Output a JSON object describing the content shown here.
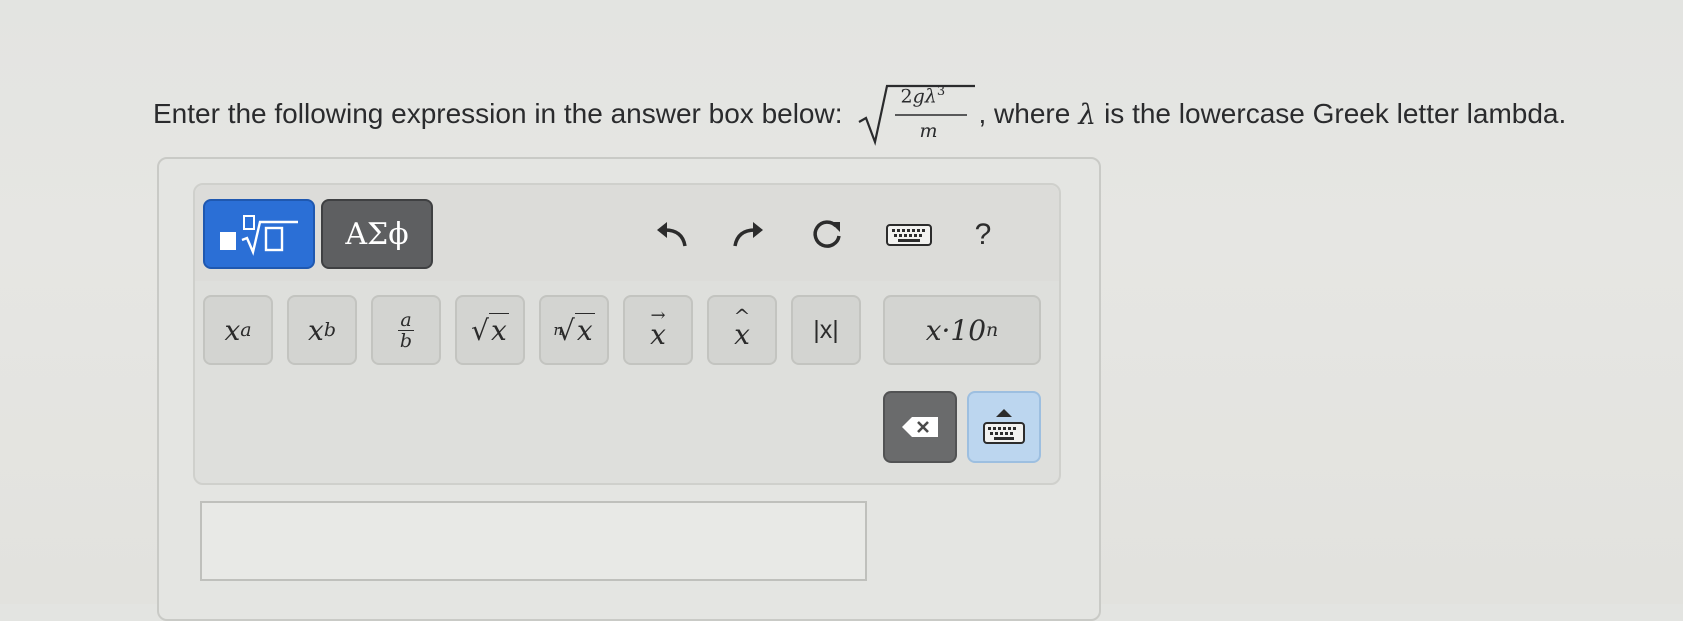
{
  "question": {
    "before": "Enter the following expression in the answer box below:",
    "expr_num_coeff": "2",
    "expr_num_g": "g",
    "expr_num_lambda": "λ",
    "expr_num_exp": "3",
    "expr_den": "m",
    "after_1": ", where",
    "lambda": "λ",
    "after_2": "is the lowercase Greek letter lambda."
  },
  "toolbar": {
    "tab_math_icon": "fraction-root-icon",
    "tab_greek_label": "ΑΣϕ",
    "help_label": "?"
  },
  "keys": {
    "superscript": {
      "base": "x",
      "sup": "a"
    },
    "subscript": {
      "base": "x",
      "sub": "b"
    },
    "fraction": {
      "num": "a",
      "den": "b"
    },
    "sqrt": {
      "body": "x"
    },
    "nthroot": {
      "index": "n",
      "body": "x"
    },
    "vector": {
      "body": "x"
    },
    "hat": {
      "body": "x"
    },
    "abs": {
      "label": "|x|"
    },
    "sci": {
      "label": "x·10",
      "exp": "n"
    }
  },
  "answer": {
    "value": ""
  }
}
